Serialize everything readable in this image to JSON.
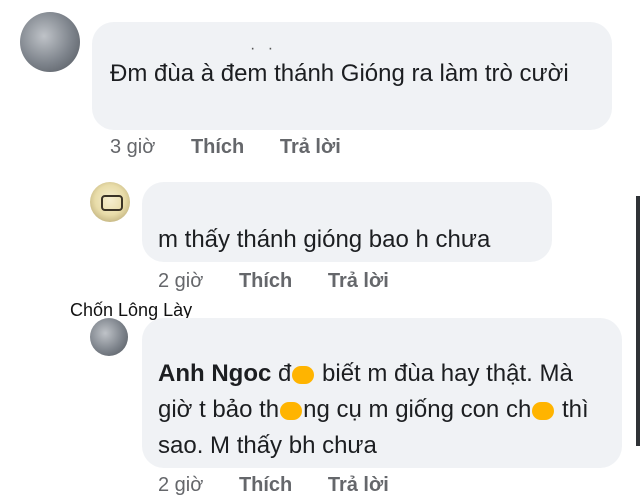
{
  "comments": [
    {
      "text": "Đm đùa à đem thánh Gióng ra làm trò cười",
      "time": "3 giờ",
      "like": "Thích",
      "reply": "Trả lời"
    },
    {
      "text": "m thấy thánh gióng bao h chưa",
      "time": "2 giờ",
      "like": "Thích",
      "reply": "Trả lời"
    },
    {
      "author": "Anh Ngoc",
      "text_parts": [
        "đ",
        " biết m đùa hay thật. Mà giờ t bảo th",
        "ng cụ m giống con ch",
        " thì sao. M thấy bh chưa"
      ],
      "time": "2 giờ",
      "like": "Thích",
      "reply": "Trả lời"
    }
  ],
  "watermark": "Chốn Lông Lày",
  "colors": {
    "bubble": "#f0f2f5",
    "meta": "#65676b",
    "censor": "#ffb400"
  }
}
